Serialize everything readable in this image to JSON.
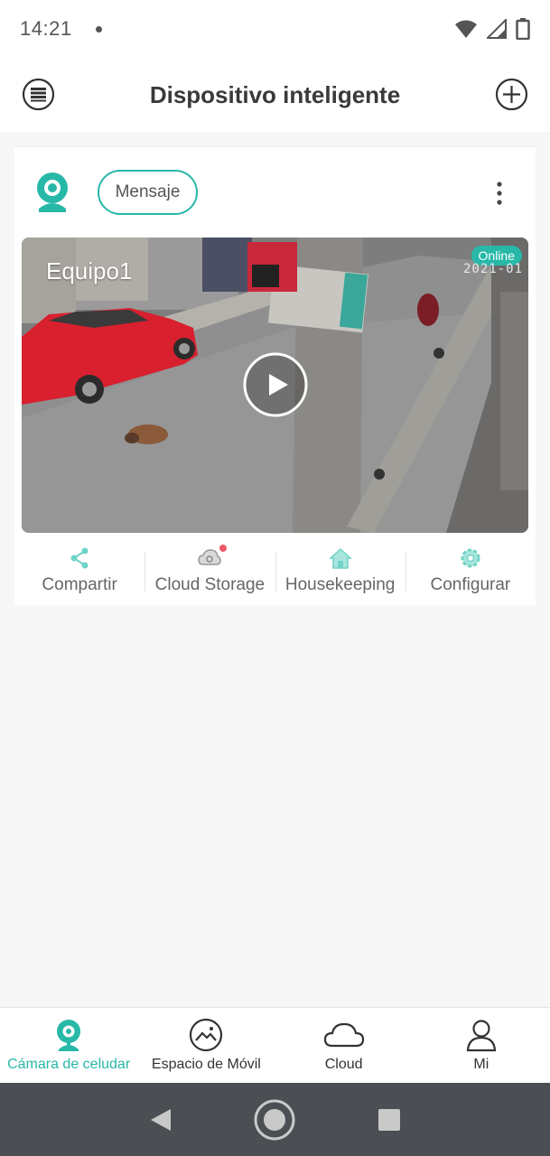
{
  "status_bar": {
    "time": "14:21",
    "icons": [
      "notification-dot",
      "wifi-icon",
      "signal-icon",
      "battery-icon"
    ]
  },
  "header": {
    "title": "Dispositivo inteligente",
    "menu_icon": "list-icon",
    "add_icon": "plus-circle-icon"
  },
  "device_card": {
    "message_label": "Mensaje",
    "device_name": "Equipo1",
    "status": "Online",
    "timestamp": "2021-01",
    "actions": [
      {
        "label": "Compartir",
        "icon": "share-icon"
      },
      {
        "label": "Cloud Storage",
        "icon": "cloud-storage-icon"
      },
      {
        "label": "Housekeeping",
        "icon": "home-icon"
      },
      {
        "label": "Configurar",
        "icon": "gear-icon"
      }
    ]
  },
  "tabs": [
    {
      "label": "Cámara de celudar",
      "icon": "camera-pin-icon",
      "active": true
    },
    {
      "label": "Espacio de Móvil",
      "icon": "gallery-icon",
      "active": false
    },
    {
      "label": "Cloud",
      "icon": "cloud-icon",
      "active": false
    },
    {
      "label": "Mi",
      "icon": "person-icon",
      "active": false
    }
  ],
  "colors": {
    "accent": "#27b8a8",
    "badge_dot": "#f05a6a",
    "nav_bar": "#4b4f54"
  }
}
